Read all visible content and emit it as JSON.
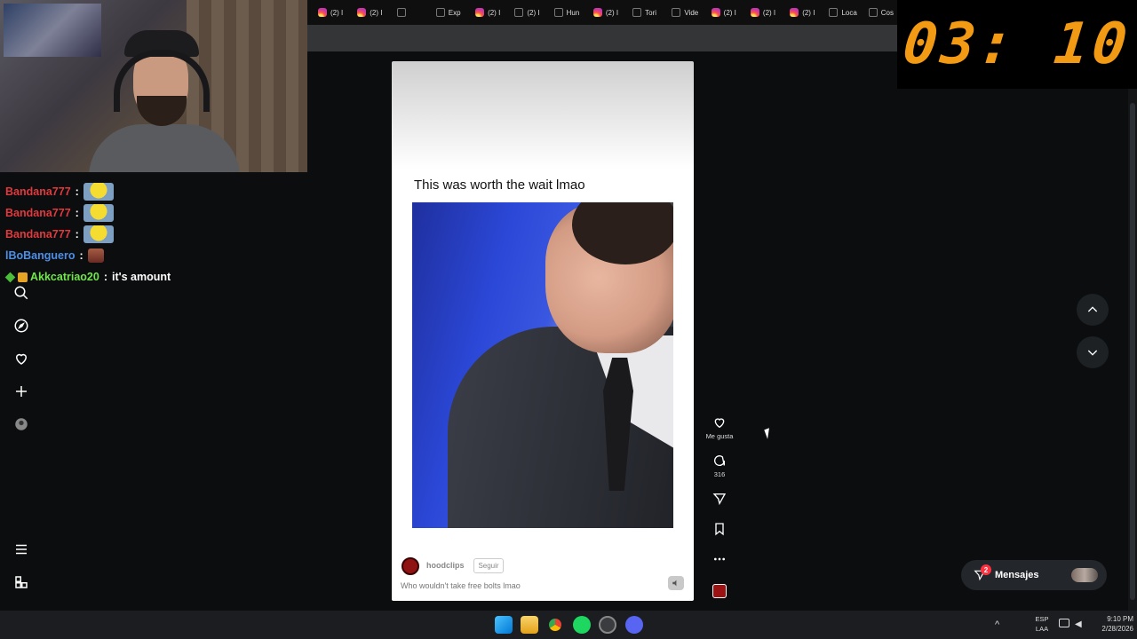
{
  "timer": {
    "value": "03: 10",
    "color": "#f29a13"
  },
  "browser": {
    "tabs": [
      {
        "icon": "instagram-icon",
        "label": "(2) I"
      },
      {
        "icon": "instagram-icon",
        "label": "(2) I"
      },
      {
        "icon": "tiktok-icon",
        "label": ""
      },
      {
        "icon": "tiktok-icon",
        "label": "Exp"
      },
      {
        "icon": "instagram-icon",
        "label": "(2) I"
      },
      {
        "icon": "tiktok-icon",
        "label": "(2) I"
      },
      {
        "icon": "tiktok-icon",
        "label": "Hun"
      },
      {
        "icon": "instagram-icon",
        "label": "(2) I"
      },
      {
        "icon": "tiktok-icon",
        "label": "Tori"
      },
      {
        "icon": "tiktok-icon",
        "label": "Vide"
      },
      {
        "icon": "instagram-icon",
        "label": "(2) I"
      },
      {
        "icon": "instagram-icon",
        "label": "(2) I"
      },
      {
        "icon": "instagram-icon",
        "label": "(2) I"
      },
      {
        "icon": "tiktok-icon",
        "label": "Loca"
      },
      {
        "icon": "tiktok-icon",
        "label": "Cos"
      }
    ]
  },
  "chat": {
    "messages": [
      {
        "user": "Bandana777",
        "sep": ":",
        "text": "",
        "emote": "minion-emote"
      },
      {
        "user": "Bandana777",
        "sep": ":",
        "text": "",
        "emote": "minion-emote"
      },
      {
        "user": "Bandana777",
        "sep": ":",
        "text": "",
        "emote": "minion-emote"
      },
      {
        "user": "lBoBanguero",
        "sep": ":",
        "text": "",
        "emote": "face-emote"
      },
      {
        "user": "Akkcatriao20",
        "sep": ":",
        "text": "it's amount",
        "emote": ""
      }
    ]
  },
  "nav": {
    "items": [
      "search-icon",
      "explore-icon",
      "heart-icon",
      "create-icon",
      "profile-icon",
      "menu-icon",
      "apps-icon"
    ]
  },
  "post": {
    "caption_top": "This was worth the wait lmao",
    "author": "hoodclips",
    "follow_label": "Seguir",
    "description": "Who wouldn't take free bolts lmao",
    "actions": {
      "like_label": "Me gusta",
      "comment_count": "316"
    }
  },
  "messages_panel": {
    "label": "Mensajes",
    "badge": "2"
  },
  "taskbar": {
    "lang_top": "ESP",
    "lang_bottom": "LAA",
    "time": "9:10 PM",
    "date": "2/28/2026"
  }
}
